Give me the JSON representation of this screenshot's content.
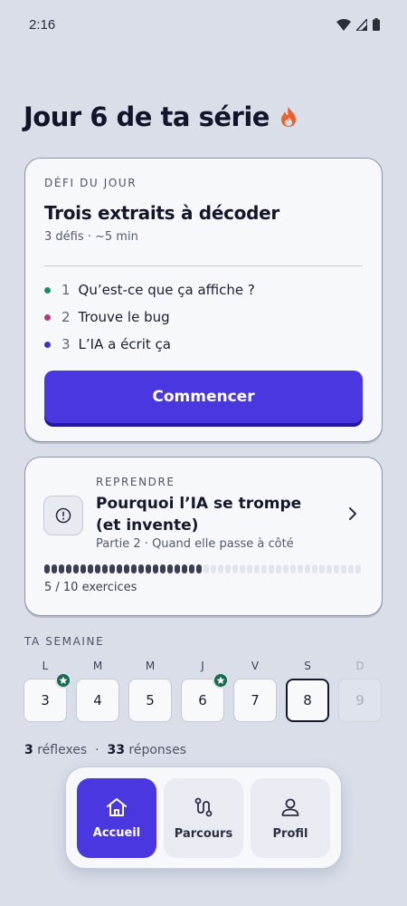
{
  "status": {
    "time": "2:16"
  },
  "header": {
    "title": "Jour 6 de ta série"
  },
  "challenge": {
    "eyebrow": "DÉFI DU JOUR",
    "title": "Trois extraits à décoder",
    "meta": "3 défis · ~5 min",
    "items": [
      {
        "num": "1",
        "label": "Qu’est-ce que ça affiche ?",
        "color": "#1f8a6b"
      },
      {
        "num": "2",
        "label": "Trouve le bug",
        "color": "#b13b7e"
      },
      {
        "num": "3",
        "label": "L’IA a écrit ça",
        "color": "#3d32c9"
      }
    ],
    "start_label": "Commencer"
  },
  "resume": {
    "eyebrow": "REPRENDRE",
    "title": "Pourquoi l’IA se trompe (et invente)",
    "subtitle": "Partie 2 · Quand elle passe à côté",
    "progress_text": "5 / 10 exercices",
    "progress_fraction": 0.5
  },
  "week": {
    "eyebrow": "TA SEMAINE",
    "days": [
      {
        "letter": "L",
        "number": "3",
        "star": true,
        "state": "done"
      },
      {
        "letter": "M",
        "number": "4",
        "star": false,
        "state": "done"
      },
      {
        "letter": "M",
        "number": "5",
        "star": false,
        "state": "done"
      },
      {
        "letter": "J",
        "number": "6",
        "star": true,
        "state": "done"
      },
      {
        "letter": "V",
        "number": "7",
        "star": false,
        "state": "done"
      },
      {
        "letter": "S",
        "number": "8",
        "star": false,
        "state": "current"
      },
      {
        "letter": "D",
        "number": "9",
        "star": false,
        "state": "future"
      }
    ]
  },
  "stats": {
    "reflexes_count": "3",
    "reflexes_label": "réflexes",
    "separator": "·",
    "answers_count": "33",
    "answers_label": "réponses"
  },
  "nav": {
    "home_label": "Accueil",
    "paths_label": "Parcours",
    "profile_label": "Profil"
  },
  "colors": {
    "accent": "#4a37e0",
    "star": "#176b4f",
    "flame": "#e8622b"
  }
}
